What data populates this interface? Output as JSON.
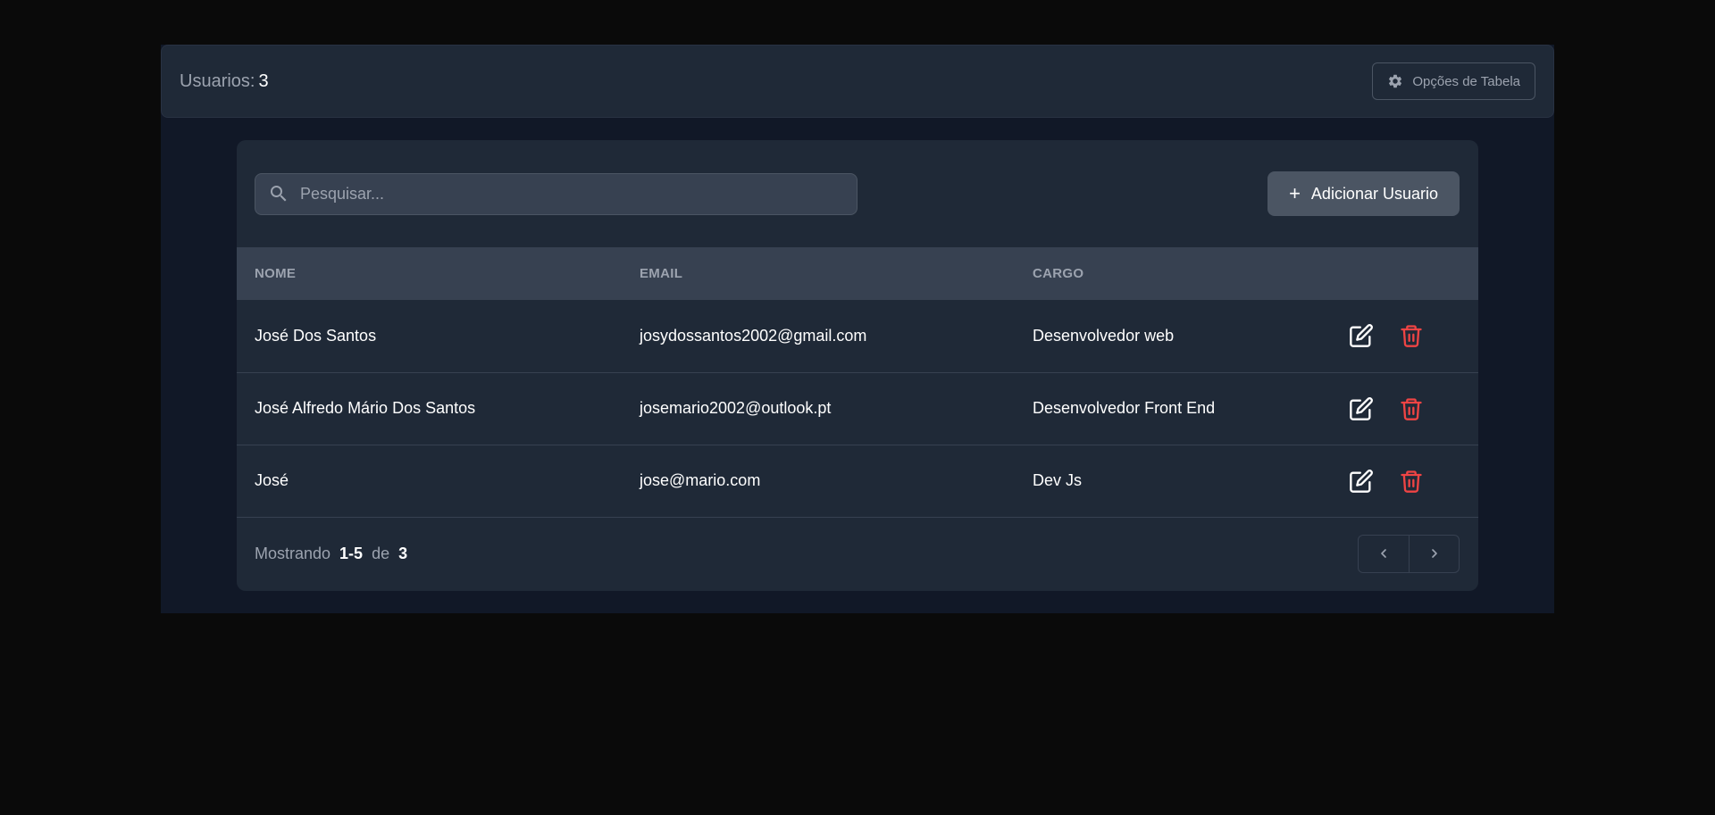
{
  "header": {
    "count_label": "Usuarios:",
    "count_value": "3",
    "table_options_label": "Opções de Tabela"
  },
  "toolbar": {
    "search_placeholder": "Pesquisar...",
    "add_button_label": "Adicionar Usuario",
    "add_icon": "plus-icon"
  },
  "table": {
    "columns": [
      "NOME",
      "EMAIL",
      "CARGO"
    ],
    "rows": [
      {
        "nome": "José Dos Santos",
        "email": "josydossantos2002@gmail.com",
        "cargo": "Desenvolvedor web"
      },
      {
        "nome": "José Alfredo Mário Dos Santos",
        "email": "josemario2002@outlook.pt",
        "cargo": "Desenvolvedor Front End"
      },
      {
        "nome": "José",
        "email": "jose@mario.com",
        "cargo": "Dev Js"
      }
    ]
  },
  "pagination": {
    "prefix": "Mostrando",
    "range": "1-5",
    "of": "de",
    "total": "3"
  },
  "colors": {
    "page_bg": "#0a0a0a",
    "panel_bg": "#1f2937",
    "header_row_bg": "#374151",
    "delete_color": "#ef4444"
  }
}
